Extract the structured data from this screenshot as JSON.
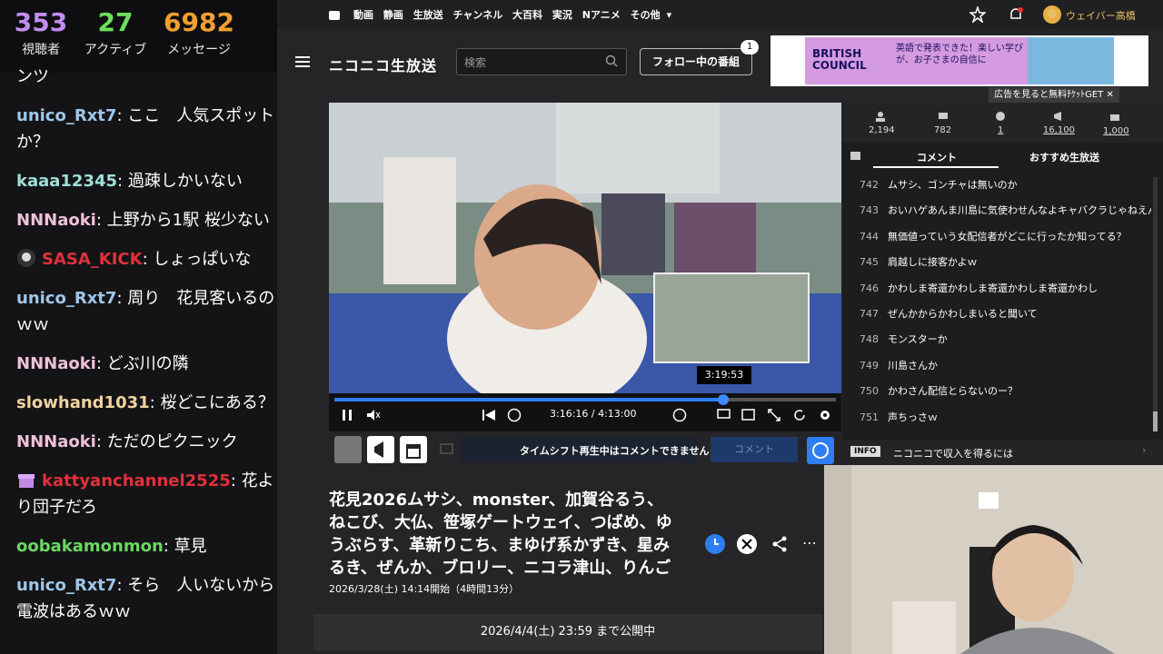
{
  "overlay_stats": [
    {
      "value": "353",
      "label": "視聴者",
      "color": "#c28cf0"
    },
    {
      "value": "27",
      "label": "アクティブ",
      "color": "#6dde5a"
    },
    {
      "value": "6982",
      "label": "メッセージ",
      "color": "#f0a030"
    }
  ],
  "chat": {
    "partial": "ンツ",
    "messages": [
      {
        "user": "unico_Rxt7",
        "text": "ここ　人気スポットか？",
        "color": "#9fc6e8"
      },
      {
        "user": "kaaa12345",
        "text": "過疎しかいない",
        "color": "#9fe0d8"
      },
      {
        "user": "NNNaoki",
        "text": "上野から1駅 桜少ない",
        "color": "#f0c0d8"
      },
      {
        "user": "SASA_KICK",
        "text": "しょっぱいな",
        "color": "#e0303c"
      },
      {
        "user": "unico_Rxt7",
        "text": "周り　花見客いるのｗｗ",
        "color": "#9fc6e8"
      },
      {
        "user": "NNNaoki",
        "text": "どぶ川の隣",
        "color": "#f0c0d8"
      },
      {
        "user": "slowhand1031",
        "text": "桜どこにある？",
        "color": "#f0d2a0"
      },
      {
        "user": "NNNaoki",
        "text": "ただのピクニック",
        "color": "#f0c0d8"
      },
      {
        "user": "kattyanchannel2525",
        "text": "花より団子だろ",
        "color": "#e0303c"
      },
      {
        "user": "oobakamonmon",
        "text": "草見",
        "color": "#6ad860"
      },
      {
        "user": "unico_Rxt7",
        "text": "そら　人いないから電波はあるｗｗ",
        "color": "#9fc6e8"
      }
    ]
  },
  "topnav": [
    "動画",
    "静画",
    "生放送",
    "チャンネル",
    "大百科",
    "実況",
    "Nアニメ",
    "その他"
  ],
  "user_name": "ウェイバー高橋",
  "logo": "ニコニコ生放送",
  "search_placeholder": "検索",
  "follow_label": "フォロー中の番組",
  "follow_count": "1",
  "ad": {
    "brand": "BRITISH COUNCIL",
    "copy": "英語で発表できた！楽しい学びが、お子さまの自信に"
  },
  "ad_gate": "広告を見ると無料ﾁｹｯﾄGET",
  "player": {
    "tooltip": "3:19:53",
    "timecode": "3:16:16 / 4:13:00",
    "progress": 0.776
  },
  "timeshift_msg": "タイムシフト再生中はコメントできません",
  "comment_btn": "コメント",
  "side_stats": [
    "2,194",
    "782",
    "1",
    "16,100",
    "1,000"
  ],
  "tabs": [
    "コメント",
    "おすすめ生放送"
  ],
  "comments": [
    {
      "num": "742",
      "text": "ムサシ、ゴンチャは無いのか"
    },
    {
      "num": "743",
      "text": "おいハゲあんま川島に気使わせんなよキャバクラじゃねえん"
    },
    {
      "num": "744",
      "text": "無価値っていう女配信者がどこに行ったか知ってる？"
    },
    {
      "num": "745",
      "text": "肩越しに接客かよｗ"
    },
    {
      "num": "746",
      "text": "かわしま寄還かわしま寄還かわしま寄還かわし"
    },
    {
      "num": "747",
      "text": "ぜんかからかわしまいると聞いて"
    },
    {
      "num": "748",
      "text": "モンスターか"
    },
    {
      "num": "749",
      "text": "川島さんか"
    },
    {
      "num": "750",
      "text": "かわさん配信とらないのー？"
    },
    {
      "num": "751",
      "text": "声ちっさｗ"
    }
  ],
  "info_tag": "INFO",
  "info_text": "ニコニコで収入を得るには",
  "title": "花見2026ムサシ、monster、加賀谷るう、ねこび、大仏、笹塚ゲートウェイ、つばめ、ゆうぶらす、革新りこち、まゆげ系かずき、星みるき、ぜんか、ブロリー、ニコラ津山、りんご",
  "broadcast_date": "2026/3/28(土) 14:14開始（4時間13分）",
  "publish_until": "2026/4/4(土) 23:59 まで公開中"
}
